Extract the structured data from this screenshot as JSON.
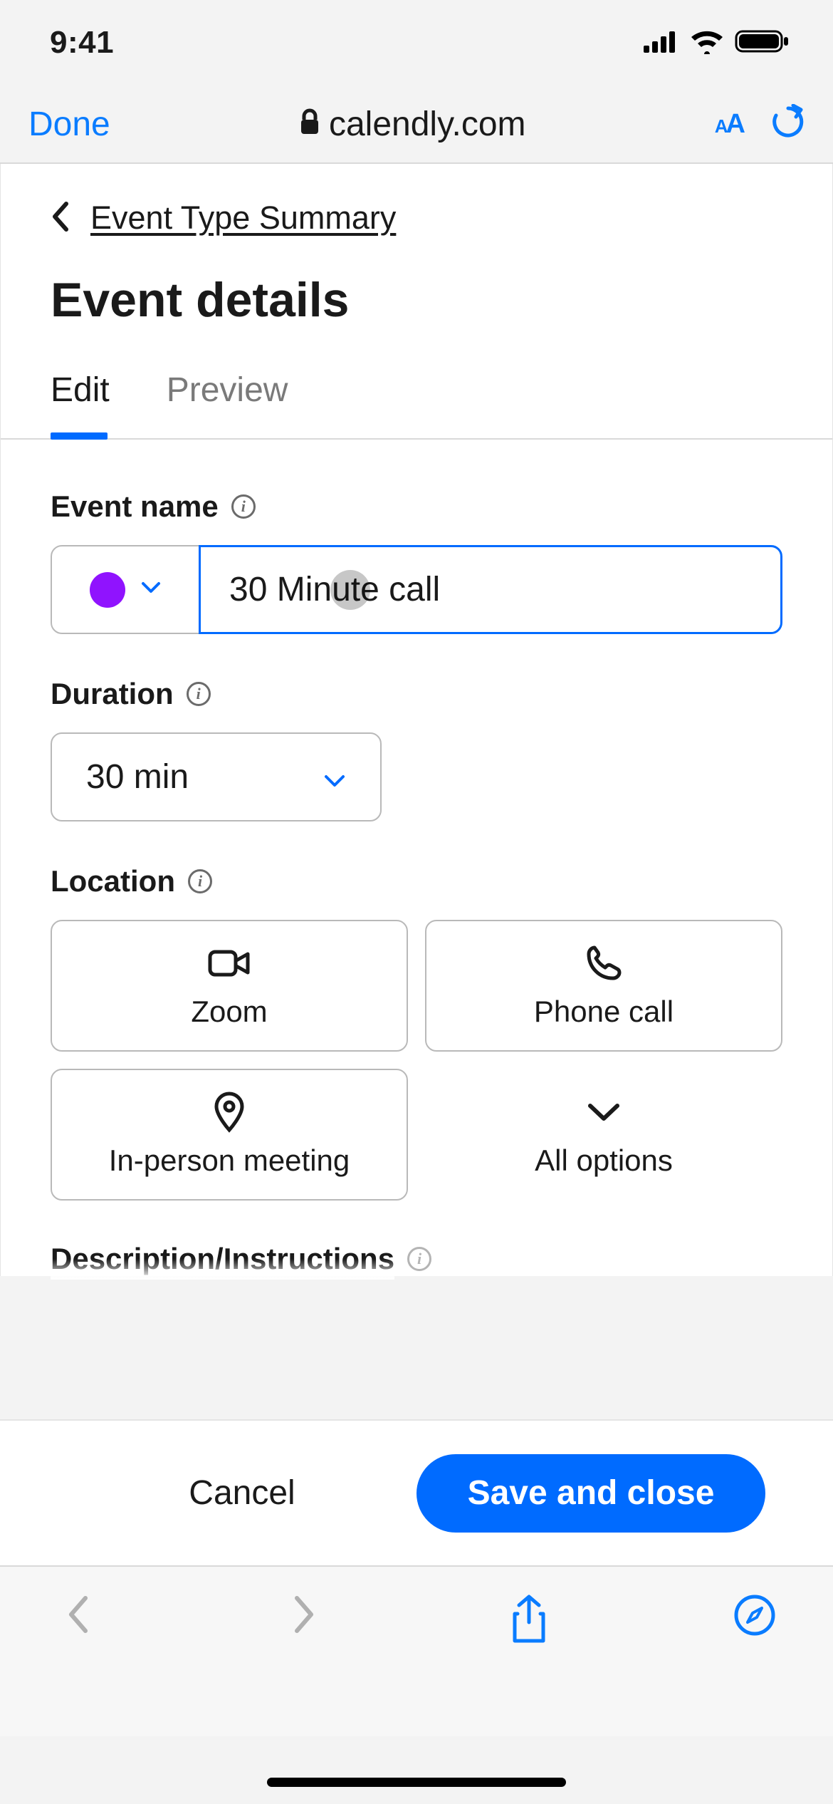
{
  "status": {
    "time": "9:41"
  },
  "safari": {
    "done": "Done",
    "url": "calendly.com"
  },
  "breadcrumb": {
    "label": "Event Type Summary"
  },
  "page_title": "Event details",
  "tabs": {
    "edit": "Edit",
    "preview": "Preview"
  },
  "form": {
    "event_name_label": "Event name",
    "event_name_value": "30 Minute call",
    "event_color": "#9013fe",
    "duration_label": "Duration",
    "duration_value": "30 min",
    "location_label": "Location",
    "locations": {
      "zoom": "Zoom",
      "phone": "Phone call",
      "inperson": "In-person meeting",
      "all": "All options"
    },
    "truncated_label": "Description/Instructions"
  },
  "footer": {
    "cancel": "Cancel",
    "save": "Save and close"
  }
}
